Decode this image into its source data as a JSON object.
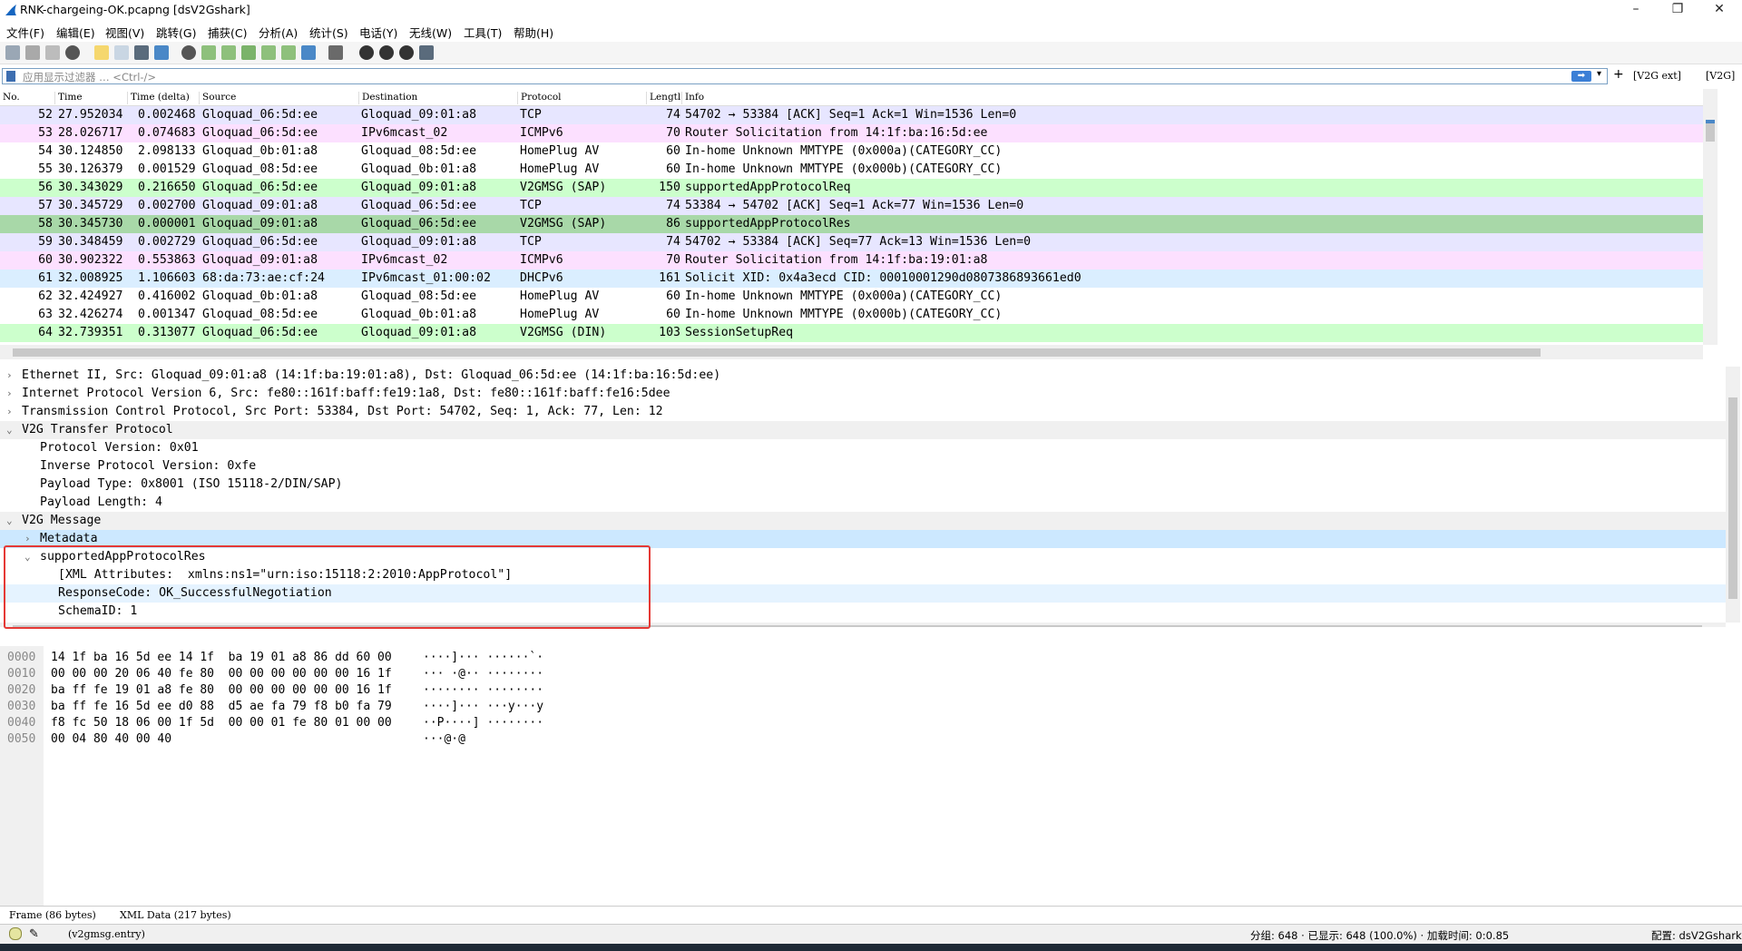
{
  "window": {
    "title": "RNK-chargeing-OK.pcapng [dsV2Gshark]"
  },
  "menu": [
    "文件(F)",
    "编辑(E)",
    "视图(V)",
    "跳转(G)",
    "捕获(C)",
    "分析(A)",
    "统计(S)",
    "电话(Y)",
    "无线(W)",
    "工具(T)",
    "帮助(H)"
  ],
  "filter": {
    "placeholder": "应用显示过滤器 … <Ctrl-/>",
    "buttons": [
      "[V2G ext]",
      "[V2G]"
    ]
  },
  "packet_list": {
    "columns": [
      "No.",
      "Time",
      "Time (delta)",
      "Source",
      "Destination",
      "Protocol",
      "Lengtl",
      "Info"
    ],
    "rows": [
      {
        "no": "52",
        "time": "27.952034",
        "delta": "0.002468",
        "src": "Gloquad_06:5d:ee",
        "dst": "Gloquad_09:01:a8",
        "proto": "TCP",
        "len": "74",
        "info": "54702 → 53384 [ACK] Seq=1 Ack=1 Win=1536 Len=0",
        "color": "#e7e6ff"
      },
      {
        "no": "53",
        "time": "28.026717",
        "delta": "0.074683",
        "src": "Gloquad_06:5d:ee",
        "dst": "IPv6mcast_02",
        "proto": "ICMPv6",
        "len": "70",
        "info": "Router Solicitation from 14:1f:ba:16:5d:ee",
        "color": "#fce0ff"
      },
      {
        "no": "54",
        "time": "30.124850",
        "delta": "2.098133",
        "src": "Gloquad_0b:01:a8",
        "dst": "Gloquad_08:5d:ee",
        "proto": "HomePlug AV",
        "len": "60",
        "info": "In-home Unknown MMTYPE (0x000a)(CATEGORY_CC)",
        "color": "#ffffff"
      },
      {
        "no": "55",
        "time": "30.126379",
        "delta": "0.001529",
        "src": "Gloquad_08:5d:ee",
        "dst": "Gloquad_0b:01:a8",
        "proto": "HomePlug AV",
        "len": "60",
        "info": "In-home Unknown MMTYPE (0x000b)(CATEGORY_CC)",
        "color": "#ffffff"
      },
      {
        "no": "56",
        "time": "30.343029",
        "delta": "0.216650",
        "src": "Gloquad_06:5d:ee",
        "dst": "Gloquad_09:01:a8",
        "proto": "V2GMSG (SAP)",
        "len": "150",
        "info": "supportedAppProtocolReq",
        "color": "#ccffcc"
      },
      {
        "no": "57",
        "time": "30.345729",
        "delta": "0.002700",
        "src": "Gloquad_09:01:a8",
        "dst": "Gloquad_06:5d:ee",
        "proto": "TCP",
        "len": "74",
        "info": "53384 → 54702 [ACK] Seq=1 Ack=77 Win=1536 Len=0",
        "color": "#e7e6ff"
      },
      {
        "no": "58",
        "time": "30.345730",
        "delta": "0.000001",
        "src": "Gloquad_09:01:a8",
        "dst": "Gloquad_06:5d:ee",
        "proto": "V2GMSG (SAP)",
        "len": "86",
        "info": "supportedAppProtocolRes",
        "color": "#a8d8a8"
      },
      {
        "no": "59",
        "time": "30.348459",
        "delta": "0.002729",
        "src": "Gloquad_06:5d:ee",
        "dst": "Gloquad_09:01:a8",
        "proto": "TCP",
        "len": "74",
        "info": "54702 → 53384 [ACK] Seq=77 Ack=13 Win=1536 Len=0",
        "color": "#e7e6ff"
      },
      {
        "no": "60",
        "time": "30.902322",
        "delta": "0.553863",
        "src": "Gloquad_09:01:a8",
        "dst": "IPv6mcast_02",
        "proto": "ICMPv6",
        "len": "70",
        "info": "Router Solicitation from 14:1f:ba:19:01:a8",
        "color": "#fce0ff"
      },
      {
        "no": "61",
        "time": "32.008925",
        "delta": "1.106603",
        "src": "68:da:73:ae:cf:24",
        "dst": "IPv6mcast_01:00:02",
        "proto": "DHCPv6",
        "len": "161",
        "info": "Solicit XID: 0x4a3ecd CID: 00010001290d0807386893661ed0",
        "color": "#daeeff"
      },
      {
        "no": "62",
        "time": "32.424927",
        "delta": "0.416002",
        "src": "Gloquad_0b:01:a8",
        "dst": "Gloquad_08:5d:ee",
        "proto": "HomePlug AV",
        "len": "60",
        "info": "In-home Unknown MMTYPE (0x000a)(CATEGORY_CC)",
        "color": "#ffffff"
      },
      {
        "no": "63",
        "time": "32.426274",
        "delta": "0.001347",
        "src": "Gloquad_08:5d:ee",
        "dst": "Gloquad_0b:01:a8",
        "proto": "HomePlug AV",
        "len": "60",
        "info": "In-home Unknown MMTYPE (0x000b)(CATEGORY_CC)",
        "color": "#ffffff"
      },
      {
        "no": "64",
        "time": "32.739351",
        "delta": "0.313077",
        "src": "Gloquad_06:5d:ee",
        "dst": "Gloquad_09:01:a8",
        "proto": "V2GMSG (DIN)",
        "len": "103",
        "info": "SessionSetupReq",
        "color": "#ccffcc"
      }
    ]
  },
  "details": [
    {
      "arrow": "›",
      "text": "Ethernet II, Src: Gloquad_09:01:a8 (14:1f:ba:19:01:a8), Dst: Gloquad_06:5d:ee (14:1f:ba:16:5d:ee)",
      "level": 0,
      "bg": "#ffffff"
    },
    {
      "arrow": "›",
      "text": "Internet Protocol Version 6, Src: fe80::161f:baff:fe19:1a8, Dst: fe80::161f:baff:fe16:5dee",
      "level": 0,
      "bg": "#ffffff"
    },
    {
      "arrow": "›",
      "text": "Transmission Control Protocol, Src Port: 53384, Dst Port: 54702, Seq: 1, Ack: 77, Len: 12",
      "level": 0,
      "bg": "#ffffff"
    },
    {
      "arrow": "⌄",
      "text": "V2G Transfer Protocol",
      "level": 0,
      "bg": "#f0f0f0"
    },
    {
      "arrow": "",
      "text": "Protocol Version: 0x01",
      "level": 1,
      "bg": "#ffffff"
    },
    {
      "arrow": "",
      "text": "Inverse Protocol Version: 0xfe",
      "level": 1,
      "bg": "#ffffff"
    },
    {
      "arrow": "",
      "text": "Payload Type: 0x8001 (ISO 15118-2/DIN/SAP)",
      "level": 1,
      "bg": "#ffffff"
    },
    {
      "arrow": "",
      "text": "Payload Length: 4",
      "level": 1,
      "bg": "#ffffff"
    },
    {
      "arrow": "⌄",
      "text": "V2G Message",
      "level": 0,
      "bg": "#f0f0f0"
    },
    {
      "arrow": "›",
      "text": "Metadata",
      "level": 1,
      "bg": "#cce8ff"
    },
    {
      "arrow": "⌄",
      "text": "supportedAppProtocolRes",
      "level": 1,
      "bg": "#ffffff"
    },
    {
      "arrow": "",
      "text": "[XML Attributes:  xmlns:ns1=\"urn:iso:15118:2:2010:AppProtocol\"]",
      "level": 2,
      "bg": "#ffffff"
    },
    {
      "arrow": "",
      "text": "ResponseCode: OK_SuccessfulNegotiation",
      "level": 2,
      "bg": "#e5f3ff"
    },
    {
      "arrow": "",
      "text": "SchemaID: 1",
      "level": 2,
      "bg": "#ffffff"
    }
  ],
  "bytes": [
    {
      "off": "0000",
      "hex": "14 1f ba 16 5d ee 14 1f  ba 19 01 a8 86 dd 60 00",
      "ascii": "····]··· ······`·"
    },
    {
      "off": "0010",
      "hex": "00 00 00 20 06 40 fe 80  00 00 00 00 00 00 16 1f",
      "ascii": "··· ·@·· ········"
    },
    {
      "off": "0020",
      "hex": "ba ff fe 19 01 a8 fe 80  00 00 00 00 00 00 16 1f",
      "ascii": "········ ········"
    },
    {
      "off": "0030",
      "hex": "ba ff fe 16 5d ee d0 88  d5 ae fa 79 f8 b0 fa 79",
      "ascii": "····]··· ···y···y"
    },
    {
      "off": "0040",
      "hex": "f8 fc 50 18 06 00 1f 5d  00 00 01 fe 80 01 00 00",
      "ascii": "··P····] ········"
    },
    {
      "off": "0050",
      "hex": "00 04 80 40 00 40",
      "ascii": "···@·@"
    }
  ],
  "tabs": [
    "Frame (86 bytes)",
    "XML Data (217 bytes)"
  ],
  "status": {
    "field": "(v2gmsg.entry)",
    "packets": "分组: 648 · 已显示: 648 (100.0%) · 加载时间: 0:0.85",
    "profile": "配置: dsV2Gshark"
  }
}
